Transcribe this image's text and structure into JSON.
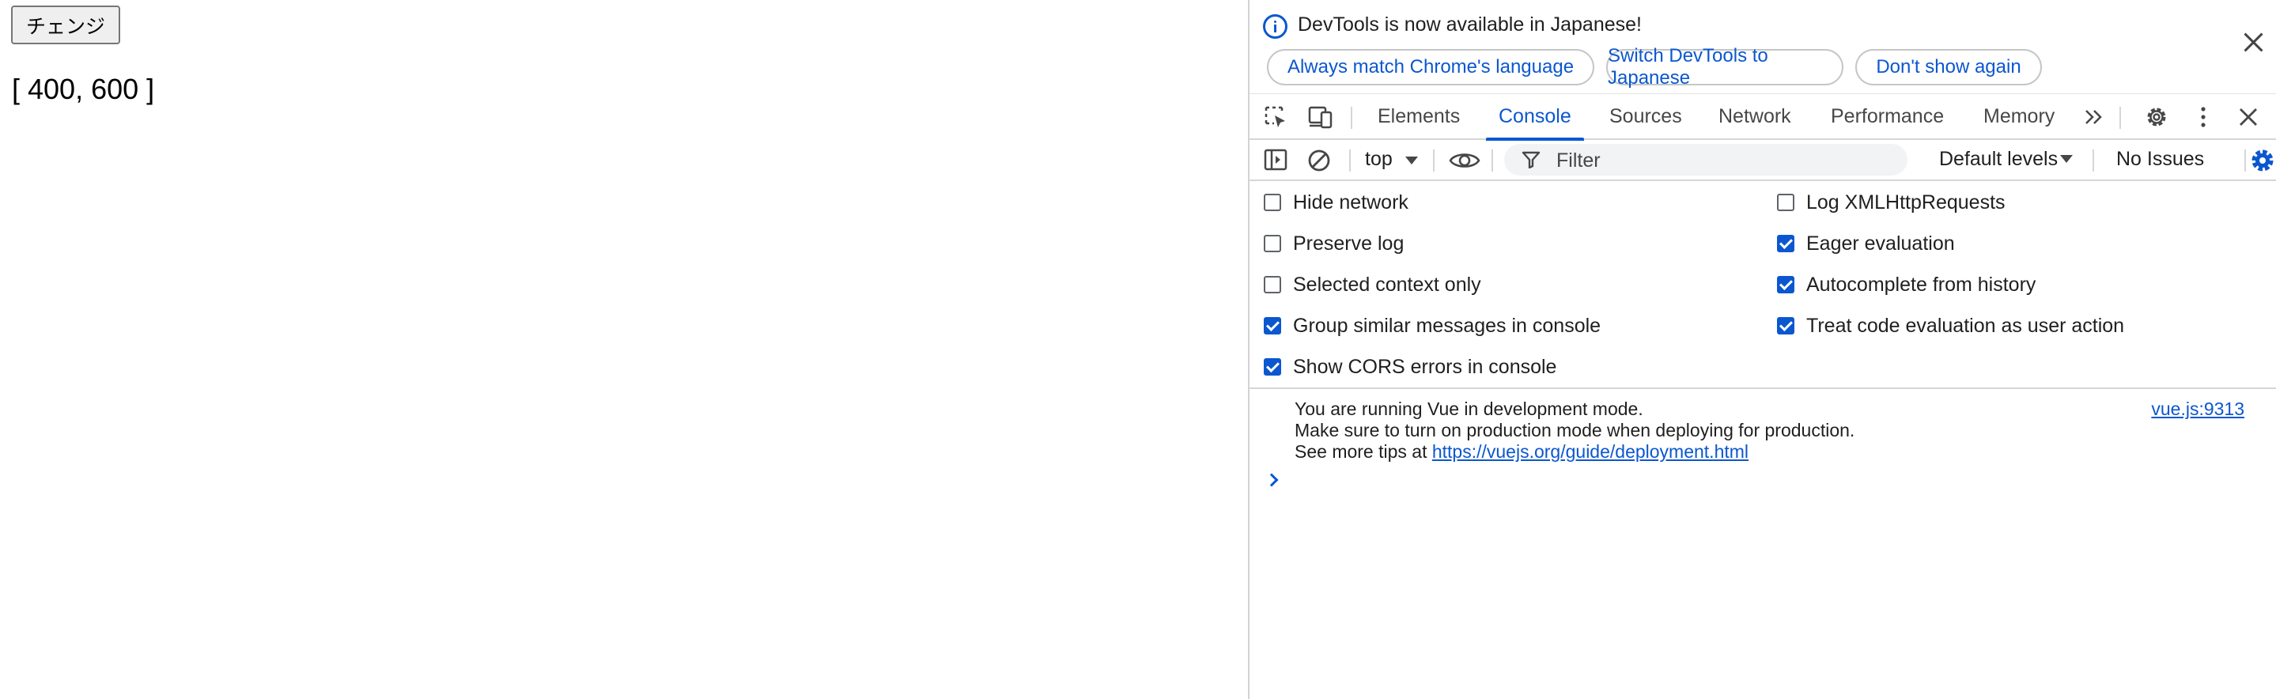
{
  "page": {
    "button_label": "チェンジ",
    "array_output": "[ 400, 600 ]"
  },
  "devtools": {
    "infobar": {
      "message": "DevTools is now available in Japanese!",
      "buttons": [
        "Always match Chrome's language",
        "Switch DevTools to Japanese",
        "Don't show again"
      ]
    },
    "tabs": [
      "Elements",
      "Console",
      "Sources",
      "Network",
      "Performance",
      "Memory"
    ],
    "active_tab": "Console",
    "toolbar": {
      "context": "top",
      "filter_placeholder": "Filter",
      "levels": "Default levels",
      "issues": "No Issues"
    },
    "settings": {
      "left": [
        {
          "label": "Hide network",
          "checked": false
        },
        {
          "label": "Preserve log",
          "checked": false
        },
        {
          "label": "Selected context only",
          "checked": false
        },
        {
          "label": "Group similar messages in console",
          "checked": true
        },
        {
          "label": "Show CORS errors in console",
          "checked": true
        }
      ],
      "right": [
        {
          "label": "Log XMLHttpRequests",
          "checked": false
        },
        {
          "label": "Eager evaluation",
          "checked": true
        },
        {
          "label": "Autocomplete from history",
          "checked": true
        },
        {
          "label": "Treat code evaluation as user action",
          "checked": true
        }
      ]
    },
    "console": {
      "line1": "You are running Vue in development mode.",
      "line2": "Make sure to turn on production mode when deploying for production.",
      "line3_prefix": "See more tips at ",
      "line3_link": "https://vuejs.org/guide/deployment.html",
      "source": "vue.js:9313"
    },
    "colors": {
      "accent": "#0b57d0",
      "border": "#d6d6d6",
      "text": "#1f1f1f"
    }
  }
}
